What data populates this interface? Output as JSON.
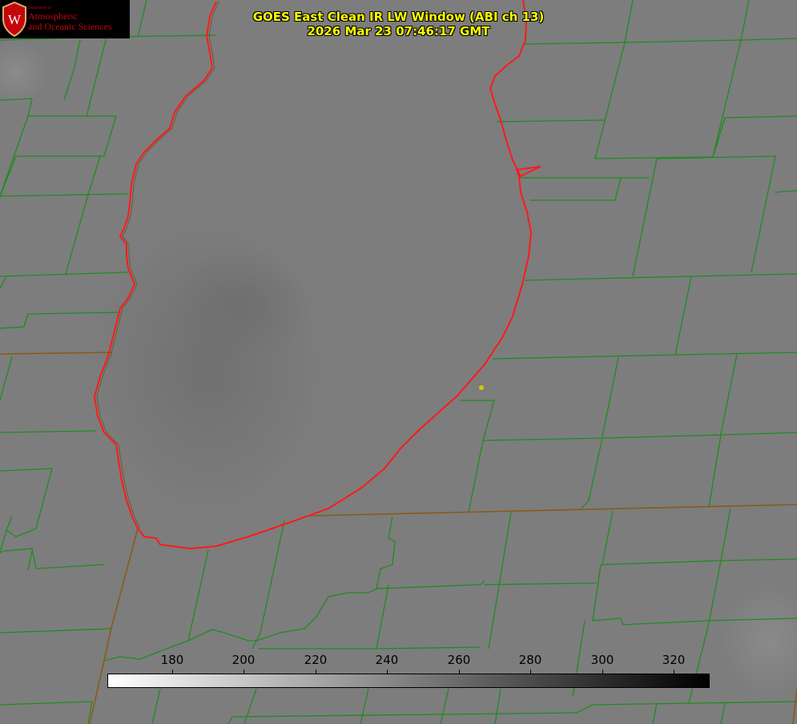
{
  "title": {
    "line1": "GOES East Clean IR LW Window (ABI ch 13)",
    "line2": "2026 Mar 23 07:46:17 GMT"
  },
  "logo": {
    "department": "Department of",
    "line1": "Atmospheric",
    "line2": "and Oceanic Sciences",
    "crest_letter": "W"
  },
  "colorbar": {
    "min": 162,
    "max": 330,
    "ticks": [
      "180",
      "200",
      "220",
      "240",
      "260",
      "280",
      "300",
      "320"
    ],
    "gradient_start": "#ffffff",
    "gradient_end": "#000000"
  },
  "colors": {
    "background_gray": "#7d7d7d",
    "county_lines": "#1e8c1e",
    "state_lines": "#8a5a1a",
    "shoreline": "#ff1a1a",
    "title_text": "#ffff00",
    "marker": "#cccc00",
    "logo_red": "#c5050c"
  },
  "icons": {
    "crest": "uw-crest-icon",
    "marker": "city-marker-dot"
  }
}
